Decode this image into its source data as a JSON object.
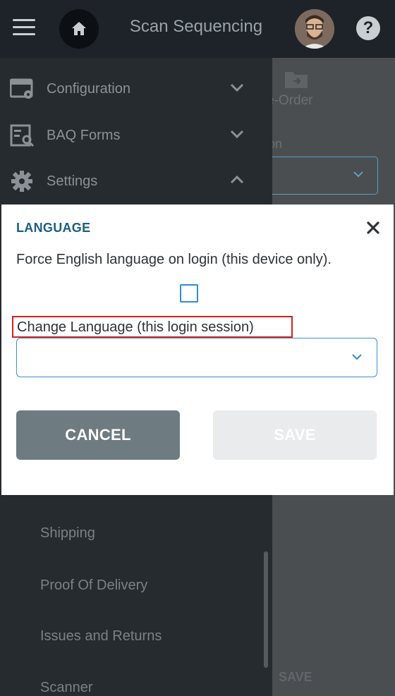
{
  "header": {
    "title": "Scan Sequencing",
    "menu_icon": "hamburger-menu-icon",
    "home_icon": "home-icon",
    "help_label": "?"
  },
  "sidebar": {
    "items": [
      {
        "label": "Configuration",
        "icon": "configuration-icon",
        "expanded": false
      },
      {
        "label": "BAQ Forms",
        "icon": "baq-forms-icon",
        "expanded": false
      },
      {
        "label": "Settings",
        "icon": "gear-icon",
        "expanded": true
      }
    ],
    "sub_items": [
      "Shipping",
      "Proof Of Delivery",
      "Issues and Returns",
      "Scanner"
    ]
  },
  "background": {
    "tab_label": "e-Order",
    "field_label": "on",
    "save_label": "SAVE"
  },
  "dialog": {
    "title": "LANGUAGE",
    "force_english_label": "Force English language on login (this device only).",
    "force_english_checked": false,
    "change_language_label": "Change Language (this login session)",
    "language_value": "",
    "cancel_label": "CANCEL",
    "save_label": "SAVE",
    "save_enabled": false
  },
  "colors": {
    "accent": "#2e8fd1",
    "title": "#1b5f82",
    "highlight": "#d62020",
    "cancel_bg": "#6e7b80",
    "save_disabled_bg": "#e9ebec"
  }
}
